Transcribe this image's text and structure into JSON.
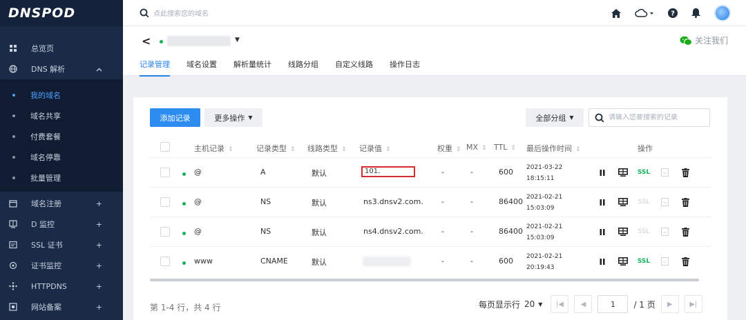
{
  "brand": {
    "logo": "DNSPOD"
  },
  "sidebar": {
    "items": [
      {
        "icon": "grid-icon",
        "label": "总览页",
        "arrow": ""
      },
      {
        "icon": "globe-icon",
        "label": "DNS 解析",
        "arrow": "^"
      }
    ],
    "sub_items": [
      {
        "label": "我的域名",
        "active": true
      },
      {
        "label": "域名共享",
        "active": false
      },
      {
        "label": "付费套餐",
        "active": false
      },
      {
        "label": "域名停靠",
        "active": false
      },
      {
        "label": "批量管理",
        "active": false
      }
    ],
    "more_items": [
      {
        "icon": "calendar-icon",
        "label": "域名注册",
        "arrow": "+"
      },
      {
        "icon": "monitor-icon",
        "label": "D 监控",
        "arrow": "+"
      },
      {
        "icon": "certificate-icon",
        "label": "SSL 证书",
        "arrow": "+"
      },
      {
        "icon": "target-icon",
        "label": "证书监控",
        "arrow": "+"
      },
      {
        "icon": "network-icon",
        "label": "HTTPDNS",
        "arrow": "+"
      },
      {
        "icon": "record-icon",
        "label": "网站备案",
        "arrow": "+"
      }
    ]
  },
  "topbar": {
    "search_placeholder": "点此搜索您的域名"
  },
  "domain_header": {
    "back": "<",
    "follow_label": "关注我们"
  },
  "tabs": [
    {
      "label": "记录管理",
      "active": true
    },
    {
      "label": "域名设置",
      "active": false
    },
    {
      "label": "解析量统计",
      "active": false
    },
    {
      "label": "线路分组",
      "active": false
    },
    {
      "label": "自定义线路",
      "active": false
    },
    {
      "label": "操作日志",
      "active": false
    }
  ],
  "toolbar": {
    "add_label": "添加记录",
    "more_label": "更多操作",
    "group_label": "全部分组",
    "search_placeholder": "请输入您要搜索的记录"
  },
  "table": {
    "columns": {
      "host": "主机记录",
      "type": "记录类型",
      "line": "线路类型",
      "value": "记录值",
      "weight": "权重",
      "mx": "MX",
      "ttl": "TTL",
      "time": "最后操作时间",
      "ops": "操作"
    },
    "rows": [
      {
        "host": "@",
        "type": "A",
        "line": "默认",
        "value": "101.",
        "value_display": "box",
        "weight": "-",
        "mx": "-",
        "ttl": "600",
        "date": "2021-03-22",
        "clock": "18:15:11",
        "ssl": "SSL",
        "ssl_active": true
      },
      {
        "host": "@",
        "type": "NS",
        "line": "默认",
        "value": "ns3.dnsv2.com.",
        "value_display": "text",
        "weight": "-",
        "mx": "-",
        "ttl": "86400",
        "date": "2021-02-21",
        "clock": "15:03:09",
        "ssl": "SSL",
        "ssl_active": false
      },
      {
        "host": "@",
        "type": "NS",
        "line": "默认",
        "value": "ns4.dnsv2.com.",
        "value_display": "text",
        "weight": "-",
        "mx": "-",
        "ttl": "86400",
        "date": "2021-02-21",
        "clock": "15:03:09",
        "ssl": "SSL",
        "ssl_active": false
      },
      {
        "host": "www",
        "type": "CNAME",
        "line": "默认",
        "value": "",
        "value_display": "blur",
        "weight": "-",
        "mx": "-",
        "ttl": "600",
        "date": "2021-02-21",
        "clock": "20:19:43",
        "ssl": "SSL",
        "ssl_active": true
      }
    ]
  },
  "footer": {
    "count_text": "第 1-4 行，共 4 行",
    "page_size_label": "每页显示行",
    "page_size": "20",
    "current_page": "1",
    "total_pages": "/ 1 页"
  },
  "colors": {
    "sidebar_bg": "#1a2b47",
    "primary": "#2d8cf0",
    "active_tab": "#2683e8",
    "status_green": "#16b05a",
    "highlight_red": "#d6282d",
    "ssl_green": "#16b05a"
  }
}
